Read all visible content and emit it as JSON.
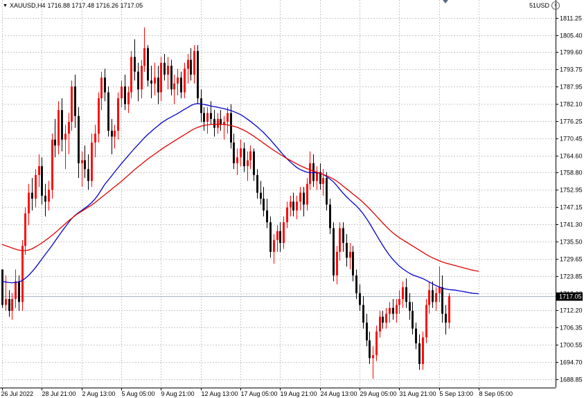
{
  "header": {
    "symbol": "XAUUSD,H4",
    "ohlc": "1716.88 1717.48 1716.26 1717.05",
    "menu_icon": "triangle-down-icon"
  },
  "account": {
    "label": "51USD",
    "close_icon": "close-icon"
  },
  "colors": {
    "bull": "#ff0000",
    "bear": "#000000",
    "ma_fast": "#0000cc",
    "ma_slow": "#e00000",
    "grid": "#c8c8c8",
    "price_line": "#a8b4c8",
    "background": "#ffffff"
  },
  "chart_data": {
    "type": "candlestick",
    "y_ticks": [
      "1811.25",
      "1805.40",
      "1799.60",
      "1793.75",
      "1787.95",
      "1782.10",
      "1776.25",
      "1770.45",
      "1764.60",
      "1758.80",
      "1752.95",
      "1747.15",
      "1741.30",
      "1735.50",
      "1729.65",
      "1723.85",
      "1718.00",
      "1712.20",
      "1706.35",
      "1700.55",
      "1694.70",
      "1688.85"
    ],
    "x_labels": [
      "26 Jul 2022",
      "28 Jul 21:00",
      "2 Aug 13:00",
      "5 Aug 05:00",
      "9 Aug 21:00",
      "12 Aug 13:00",
      "17 Aug 05:00",
      "19 Aug 21:00",
      "24 Aug 13:00",
      "29 Aug 05:00",
      "31 Aug 21:00",
      "5 Sep 13:00",
      "8 Sep 05:00"
    ],
    "x_label_positions": [
      0,
      12,
      24,
      36,
      48,
      60,
      72,
      84,
      96,
      108,
      120,
      132,
      144
    ],
    "ylim": [
      1686.0,
      1814.0
    ],
    "grid": true,
    "current_price": "1717.05",
    "candles": [
      [
        1726,
        1726,
        1713,
        1714
      ],
      [
        1714,
        1724,
        1712,
        1716
      ],
      [
        1716,
        1719,
        1710,
        1712
      ],
      [
        1712,
        1718,
        1709,
        1716
      ],
      [
        1716,
        1726,
        1713,
        1722
      ],
      [
        1722,
        1724,
        1712,
        1715
      ],
      [
        1715,
        1736,
        1712,
        1734
      ],
      [
        1734,
        1747,
        1731,
        1745
      ],
      [
        1745,
        1755,
        1741,
        1752
      ],
      [
        1752,
        1757,
        1746,
        1750
      ],
      [
        1750,
        1760,
        1747,
        1758
      ],
      [
        1758,
        1765,
        1754,
        1761
      ],
      [
        1761,
        1764,
        1748,
        1751
      ],
      [
        1751,
        1755,
        1744,
        1749
      ],
      [
        1749,
        1756,
        1746,
        1753
      ],
      [
        1753,
        1772,
        1750,
        1770
      ],
      [
        1770,
        1777,
        1764,
        1768
      ],
      [
        1768,
        1783,
        1765,
        1780
      ],
      [
        1780,
        1784,
        1766,
        1770
      ],
      [
        1770,
        1775,
        1760,
        1772
      ],
      [
        1772,
        1779,
        1765,
        1776
      ],
      [
        1776,
        1790,
        1773,
        1788
      ],
      [
        1788,
        1792,
        1774,
        1778
      ],
      [
        1778,
        1781,
        1757,
        1762
      ],
      [
        1762,
        1766,
        1754,
        1763
      ],
      [
        1763,
        1768,
        1757,
        1760
      ],
      [
        1760,
        1765,
        1753,
        1756
      ],
      [
        1756,
        1772,
        1754,
        1769
      ],
      [
        1769,
        1775,
        1764,
        1772
      ],
      [
        1772,
        1786,
        1769,
        1784
      ],
      [
        1784,
        1793,
        1780,
        1791
      ],
      [
        1791,
        1794,
        1783,
        1786
      ],
      [
        1786,
        1788,
        1771,
        1773
      ],
      [
        1773,
        1777,
        1765,
        1771
      ],
      [
        1771,
        1775,
        1767,
        1773
      ],
      [
        1773,
        1786,
        1770,
        1784
      ],
      [
        1784,
        1790,
        1781,
        1788
      ],
      [
        1788,
        1792,
        1780,
        1782
      ],
      [
        1782,
        1788,
        1779,
        1786
      ],
      [
        1786,
        1800,
        1784,
        1798
      ],
      [
        1798,
        1804,
        1790,
        1793
      ],
      [
        1793,
        1796,
        1783,
        1787
      ],
      [
        1787,
        1797,
        1784,
        1795
      ],
      [
        1795,
        1808,
        1793,
        1801
      ],
      [
        1801,
        1802,
        1788,
        1790
      ],
      [
        1790,
        1795,
        1784,
        1789
      ],
      [
        1789,
        1796,
        1785,
        1791
      ],
      [
        1791,
        1795,
        1782,
        1786
      ],
      [
        1786,
        1798,
        1783,
        1796
      ],
      [
        1796,
        1799,
        1790,
        1792
      ],
      [
        1792,
        1798,
        1787,
        1795
      ],
      [
        1795,
        1797,
        1785,
        1787
      ],
      [
        1787,
        1792,
        1782,
        1789
      ],
      [
        1789,
        1794,
        1785,
        1791
      ],
      [
        1791,
        1793,
        1784,
        1786
      ],
      [
        1786,
        1796,
        1784,
        1794
      ],
      [
        1794,
        1799,
        1789,
        1797
      ],
      [
        1797,
        1801,
        1790,
        1792
      ],
      [
        1792,
        1802,
        1789,
        1800
      ],
      [
        1800,
        1802,
        1782,
        1784
      ],
      [
        1784,
        1787,
        1776,
        1779
      ],
      [
        1779,
        1781,
        1773,
        1776
      ],
      [
        1776,
        1781,
        1772,
        1779
      ],
      [
        1779,
        1783,
        1775,
        1777
      ],
      [
        1777,
        1780,
        1771,
        1774
      ],
      [
        1774,
        1779,
        1772,
        1777
      ],
      [
        1777,
        1780,
        1773,
        1775
      ],
      [
        1775,
        1778,
        1770,
        1776
      ],
      [
        1776,
        1781,
        1772,
        1779
      ],
      [
        1779,
        1782,
        1767,
        1769
      ],
      [
        1769,
        1772,
        1760,
        1762
      ],
      [
        1762,
        1767,
        1758,
        1764
      ],
      [
        1764,
        1770,
        1761,
        1767
      ],
      [
        1767,
        1769,
        1759,
        1761
      ],
      [
        1761,
        1766,
        1756,
        1763
      ],
      [
        1763,
        1768,
        1760,
        1766
      ],
      [
        1766,
        1767,
        1756,
        1758
      ],
      [
        1758,
        1760,
        1750,
        1752
      ],
      [
        1752,
        1756,
        1748,
        1750
      ],
      [
        1750,
        1754,
        1744,
        1746
      ],
      [
        1746,
        1750,
        1740,
        1742
      ],
      [
        1742,
        1744,
        1730,
        1732
      ],
      [
        1732,
        1738,
        1728,
        1736
      ],
      [
        1736,
        1741,
        1732,
        1739
      ],
      [
        1739,
        1742,
        1732,
        1735
      ],
      [
        1735,
        1744,
        1733,
        1742
      ],
      [
        1742,
        1749,
        1740,
        1747
      ],
      [
        1747,
        1751,
        1744,
        1749
      ],
      [
        1749,
        1752,
        1744,
        1746
      ],
      [
        1746,
        1751,
        1743,
        1749
      ],
      [
        1749,
        1754,
        1746,
        1752
      ],
      [
        1752,
        1754,
        1744,
        1748
      ],
      [
        1748,
        1757,
        1746,
        1755
      ],
      [
        1755,
        1766,
        1753,
        1762
      ],
      [
        1762,
        1765,
        1754,
        1756
      ],
      [
        1756,
        1761,
        1753,
        1759
      ],
      [
        1759,
        1762,
        1753,
        1755
      ],
      [
        1755,
        1760,
        1751,
        1757
      ],
      [
        1757,
        1759,
        1746,
        1748
      ],
      [
        1748,
        1750,
        1738,
        1740
      ],
      [
        1740,
        1742,
        1722,
        1724
      ],
      [
        1724,
        1734,
        1721,
        1732
      ],
      [
        1732,
        1742,
        1729,
        1740
      ],
      [
        1740,
        1742,
        1732,
        1735
      ],
      [
        1735,
        1738,
        1727,
        1730
      ],
      [
        1730,
        1735,
        1726,
        1732
      ],
      [
        1732,
        1734,
        1722,
        1724
      ],
      [
        1724,
        1726,
        1716,
        1718
      ],
      [
        1718,
        1721,
        1712,
        1714
      ],
      [
        1714,
        1717,
        1706,
        1708
      ],
      [
        1708,
        1711,
        1700,
        1702
      ],
      [
        1702,
        1705,
        1694,
        1696
      ],
      [
        1696,
        1700,
        1689,
        1697
      ],
      [
        1697,
        1707,
        1695,
        1705
      ],
      [
        1705,
        1712,
        1703,
        1710
      ],
      [
        1710,
        1712,
        1706,
        1708
      ],
      [
        1708,
        1713,
        1706,
        1711
      ],
      [
        1711,
        1715,
        1708,
        1713
      ],
      [
        1713,
        1716,
        1709,
        1711
      ],
      [
        1711,
        1716,
        1708,
        1714
      ],
      [
        1714,
        1719,
        1711,
        1716
      ],
      [
        1716,
        1722,
        1713,
        1720
      ],
      [
        1720,
        1723,
        1713,
        1715
      ],
      [
        1715,
        1718,
        1709,
        1712
      ],
      [
        1712,
        1715,
        1704,
        1706
      ],
      [
        1706,
        1708,
        1699,
        1701
      ],
      [
        1701,
        1704,
        1692,
        1694
      ],
      [
        1694,
        1705,
        1692,
        1703
      ],
      [
        1703,
        1716,
        1701,
        1714
      ],
      [
        1714,
        1722,
        1711,
        1719
      ],
      [
        1719,
        1722,
        1713,
        1715
      ],
      [
        1715,
        1720,
        1712,
        1718
      ],
      [
        1718,
        1727,
        1715,
        1720
      ],
      [
        1720,
        1724,
        1708,
        1711
      ],
      [
        1711,
        1714,
        1704,
        1708
      ],
      [
        1708,
        1718,
        1706,
        1717
      ]
    ],
    "series": [
      {
        "name": "MA fast",
        "values": [
          1722,
          1721.8,
          1721.6,
          1721.5,
          1721.6,
          1721.8,
          1722.2,
          1723,
          1724,
          1725.2,
          1726.5,
          1728,
          1729.5,
          1731,
          1732.5,
          1734,
          1735.6,
          1737.2,
          1738.8,
          1740.3,
          1741.8,
          1743.2,
          1744.3,
          1745.2,
          1746,
          1746.8,
          1747.6,
          1748.6,
          1749.8,
          1751.3,
          1753,
          1754.8,
          1756.2,
          1757.6,
          1759,
          1760.4,
          1761.8,
          1763.1,
          1764.4,
          1765.7,
          1767,
          1768.2,
          1769.4,
          1770.6,
          1771.7,
          1772.7,
          1773.7,
          1774.6,
          1775.5,
          1776.3,
          1777,
          1777.6,
          1778.2,
          1778.8,
          1779.5,
          1780.2,
          1780.8,
          1781.5,
          1782,
          1782.2,
          1782.1,
          1781.9,
          1781.7,
          1781.4,
          1781.2,
          1781.0,
          1780.7,
          1780.5,
          1780.2,
          1779.9,
          1779.5,
          1779.0,
          1778.5,
          1777.8,
          1777.0,
          1776.2,
          1775.3,
          1774.4,
          1773.4,
          1772.4,
          1771.2,
          1770.0,
          1768.7,
          1767.4,
          1766.1,
          1764.8,
          1763.6,
          1762.5,
          1761.5,
          1760.6,
          1759.9,
          1759.4,
          1759.0,
          1758.8,
          1758.8,
          1758.8,
          1758.6,
          1758.2,
          1757.5,
          1756.7,
          1755.8,
          1754.6,
          1753.2,
          1751.9,
          1750.7,
          1749.6,
          1748.6,
          1747.6,
          1746.4,
          1745.0,
          1743.4,
          1741.7,
          1739.8,
          1737.9,
          1736.0,
          1734.2,
          1732.5,
          1730.9,
          1729.5,
          1728.3,
          1727.2,
          1726.3,
          1725.5,
          1724.8,
          1724.2,
          1723.8,
          1723.4,
          1723.0,
          1722.4,
          1721.8,
          1721.2,
          1720.6,
          1720.1,
          1719.7,
          1719.4,
          1719.2,
          1719.1,
          1719.0,
          1718.8,
          1718.6,
          1718.4,
          1718.2,
          1718.0,
          1717.9,
          1717.8
        ]
      },
      {
        "name": "MA slow",
        "values": [
          1734.5,
          1734.1,
          1733.7,
          1733.3,
          1732.9,
          1732.6,
          1732.4,
          1732.4,
          1732.6,
          1733.0,
          1733.6,
          1734.3,
          1735.0,
          1735.8,
          1736.6,
          1737.5,
          1738.4,
          1739.4,
          1740.4,
          1741.4,
          1742.4,
          1743.3,
          1744.2,
          1745.0,
          1745.7,
          1746.4,
          1747.1,
          1747.8,
          1748.6,
          1749.5,
          1750.4,
          1751.3,
          1752.2,
          1753.1,
          1754.0,
          1754.9,
          1755.8,
          1756.8,
          1757.8,
          1758.8,
          1759.8,
          1760.7,
          1761.6,
          1762.5,
          1763.4,
          1764.2,
          1765.0,
          1765.8,
          1766.6,
          1767.4,
          1768.1,
          1768.8,
          1769.5,
          1770.2,
          1770.9,
          1771.6,
          1772.3,
          1773.0,
          1773.6,
          1774.1,
          1774.5,
          1774.8,
          1775.0,
          1775.1,
          1775.2,
          1775.2,
          1775.2,
          1775.1,
          1775.0,
          1774.8,
          1774.5,
          1774.2,
          1773.7,
          1773.2,
          1772.6,
          1771.9,
          1771.2,
          1770.4,
          1769.6,
          1768.8,
          1768.0,
          1767.2,
          1766.4,
          1765.7,
          1765.0,
          1764.3,
          1763.6,
          1763.0,
          1762.4,
          1761.8,
          1761.2,
          1760.7,
          1760.2,
          1759.8,
          1759.4,
          1759.0,
          1758.6,
          1758.2,
          1757.8,
          1757.3,
          1756.7,
          1756.0,
          1755.2,
          1754.3,
          1753.4,
          1752.5,
          1751.6,
          1750.7,
          1749.8,
          1748.8,
          1747.7,
          1746.6,
          1745.4,
          1744.2,
          1743.0,
          1741.8,
          1740.6,
          1739.5,
          1738.5,
          1737.6,
          1736.8,
          1736.1,
          1735.4,
          1734.7,
          1734.0,
          1733.3,
          1732.6,
          1731.9,
          1731.2,
          1730.6,
          1730.0,
          1729.5,
          1729.0,
          1728.6,
          1728.2,
          1727.9,
          1727.6,
          1727.3,
          1727.0,
          1726.7,
          1726.4,
          1726.1,
          1725.8,
          1725.6,
          1725.4
        ]
      }
    ]
  }
}
